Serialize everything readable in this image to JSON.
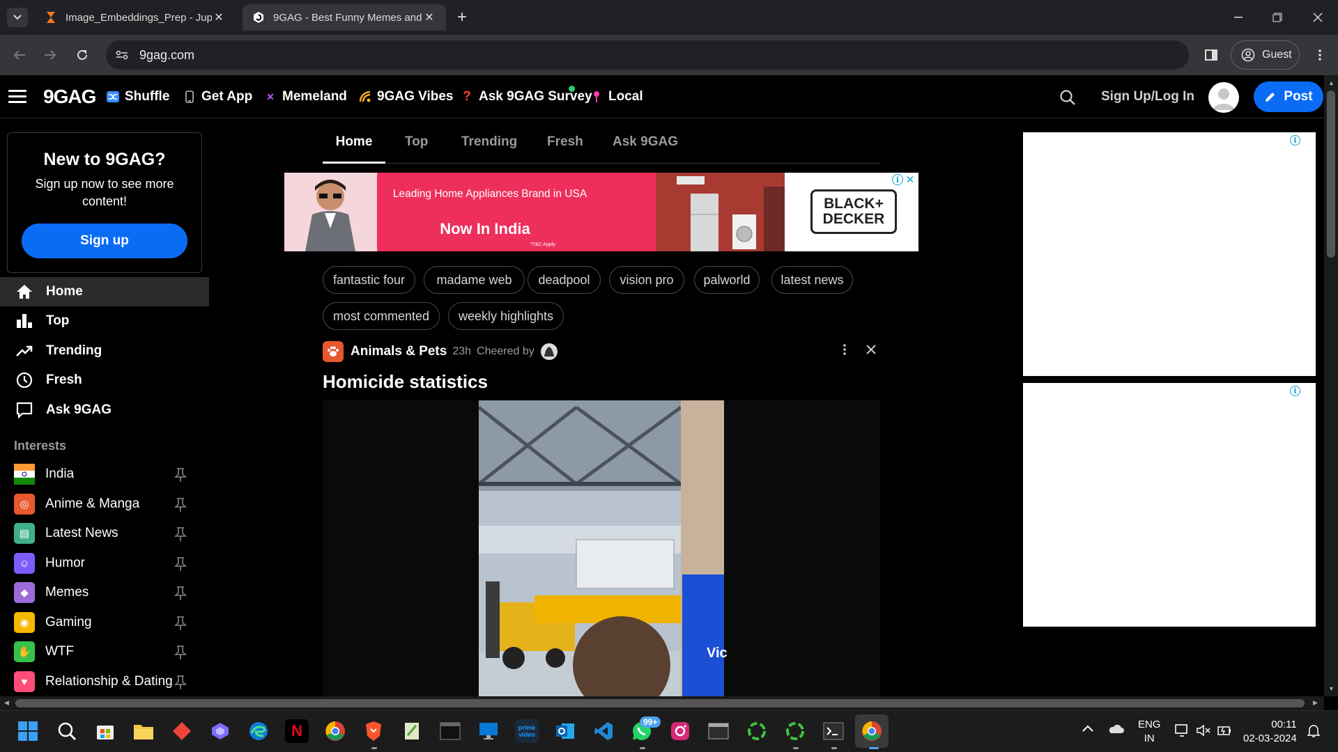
{
  "browser": {
    "tabs": [
      {
        "title": "Image_Embeddings_Prep - Jupyter",
        "icon": "hourglass-icon"
      },
      {
        "title": "9GAG - Best Funny Memes and",
        "icon": "9gag-icon"
      }
    ],
    "url": "9gag.com",
    "guest_label": "Guest"
  },
  "header": {
    "logo": "9GAG",
    "nav": [
      {
        "label": "Shuffle",
        "icon": "shuffle-icon",
        "color": "#3b8fff"
      },
      {
        "label": "Get App",
        "icon": "phone-icon",
        "color": "#9a9a9a"
      },
      {
        "label": "Memeland",
        "icon": "memeland-icon",
        "color": "#b25cff"
      },
      {
        "label": "9GAG Vibes",
        "icon": "vibes-icon",
        "color": "#ffb020"
      },
      {
        "label": "Ask 9GAG Survey",
        "icon": "question-icon",
        "color": "#ff3b3b"
      },
      {
        "label": "Local",
        "icon": "pin-icon",
        "color": "#ff3bb2"
      }
    ],
    "signup_login": "Sign Up/Log In",
    "post_label": "Post"
  },
  "signup_card": {
    "title": "New to 9GAG?",
    "subtitle": "Sign up now to see more content!",
    "button": "Sign up"
  },
  "sidebar": {
    "items": [
      {
        "label": "Home",
        "icon": "home-icon"
      },
      {
        "label": "Top",
        "icon": "bar-chart-icon"
      },
      {
        "label": "Trending",
        "icon": "trending-icon"
      },
      {
        "label": "Fresh",
        "icon": "clock-icon"
      },
      {
        "label": "Ask 9GAG",
        "icon": "speech-bubble-icon"
      }
    ],
    "interests_label": "Interests",
    "interests": [
      {
        "label": "India",
        "color": "#ff9933"
      },
      {
        "label": "Anime & Manga",
        "color": "#e8572d"
      },
      {
        "label": "Latest News",
        "color": "#3fb08c"
      },
      {
        "label": "Humor",
        "color": "#7b5cff"
      },
      {
        "label": "Memes",
        "color": "#9d6bd8"
      },
      {
        "label": "Gaming",
        "color": "#f5b800"
      },
      {
        "label": "WTF",
        "color": "#36c24a"
      },
      {
        "label": "Relationship & Dating",
        "color": "#ff4d7a"
      }
    ]
  },
  "content_tabs": [
    "Home",
    "Top",
    "Trending",
    "Fresh",
    "Ask 9GAG"
  ],
  "ad": {
    "headline": "Leading Home Appliances Brand in USA",
    "cta": "Now In India",
    "fine_print": "*T&C Apply",
    "brand": "BLACK+ DECKER"
  },
  "chips": [
    "fantastic four",
    "madame web",
    "deadpool",
    "vision pro",
    "palworld",
    "latest news",
    "most commented",
    "weekly highlights"
  ],
  "post": {
    "category": "Animals & Pets",
    "age": "23h",
    "cheered": "Cheered by",
    "title": "Homicide statistics",
    "media_text": "Vic"
  },
  "taskbar": {
    "lang_top": "ENG",
    "lang_bottom": "IN",
    "time": "00:11",
    "date": "02-03-2024",
    "whatsapp_badge": "99+"
  }
}
